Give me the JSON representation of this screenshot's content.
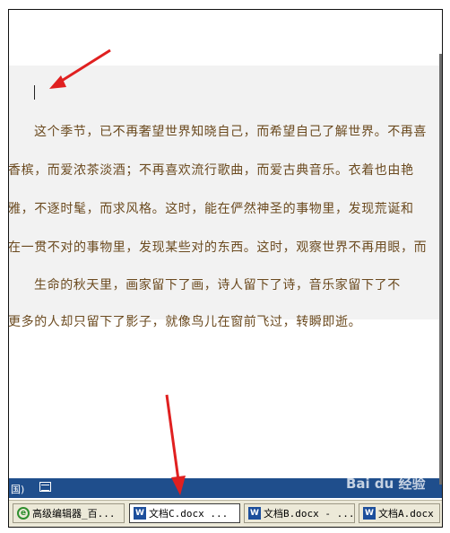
{
  "document": {
    "lines": [
      "这个季节，已不再奢望世界知晓自己，而希望自己了解世界。不再喜",
      "香槟，而爱浓茶淡酒；不再喜欢流行歌曲，而爱古典音乐。衣着也由艳",
      "雅，不逐时髦，而求风格。这时，能在俨然神圣的事物里，发现荒诞和",
      "在一贯不对的事物里，发现某些对的东西。这时，观察世界不再用眼，而",
      "生命的秋天里，画家留下了画，诗人留下了诗，音乐家留下了不",
      "更多的人却只留下了影子，就像鸟儿在窗前飞过，转瞬即逝。"
    ]
  },
  "status_bar": {
    "text": "国)"
  },
  "taskbar": {
    "items": [
      {
        "label": "高级编辑器_百...",
        "icon": "ie-icon",
        "active": false
      },
      {
        "label": "文档C.docx ...",
        "icon": "word-icon",
        "active": true
      },
      {
        "label": "文档B.docx - ...",
        "icon": "word-icon",
        "active": false
      },
      {
        "label": "文档A.docx -",
        "icon": "word-icon",
        "active": false
      }
    ]
  },
  "watermark": "Bai du 经验",
  "colors": {
    "text": "#6b4a1f",
    "arrow": "#e02020",
    "status_bar": "#1f4e8c"
  }
}
